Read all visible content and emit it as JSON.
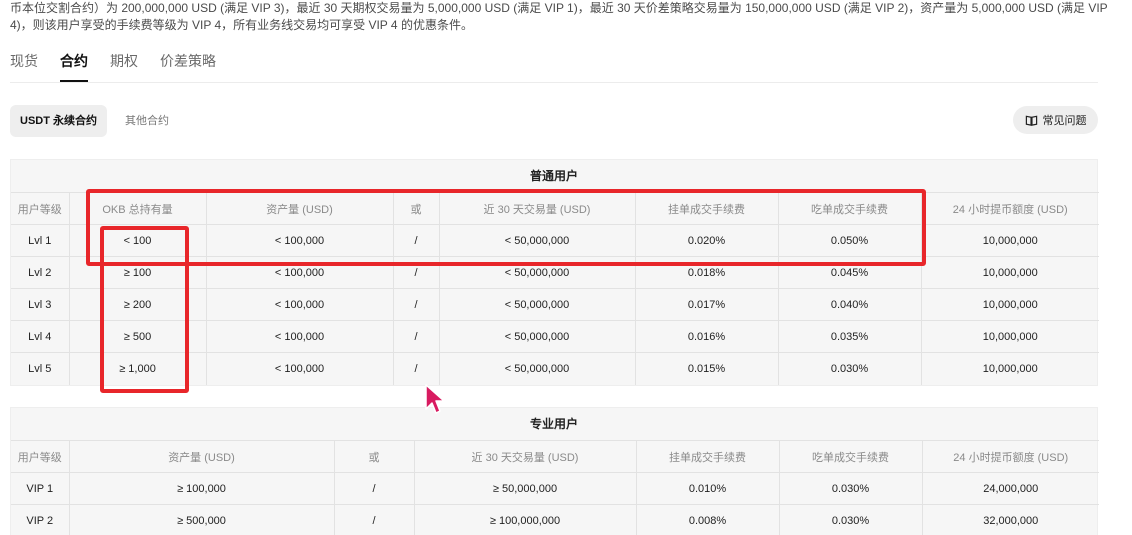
{
  "intro_text": "币本位交割合约）为 200,000,000 USD (满足 VIP 3)，最近 30 天期权交易量为 5,000,000 USD (满足 VIP 1)，最近 30 天价差策略交易量为 150,000,000 USD (满足 VIP 2)，资产量为 5,000,000 USD (满足 VIP 4)，则该用户享受的手续费等级为 VIP 4，所有业务线交易均可享受 VIP 4 的优惠条件。",
  "tabs": [
    "现货",
    "合约",
    "期权",
    "价差策略"
  ],
  "active_tab": "合约",
  "subtabs": [
    "USDT 永续合约",
    "其他合约"
  ],
  "faq_label": "常见问题",
  "regular": {
    "title": "普通用户",
    "columns": [
      "用户等级",
      "OKB 总持有量",
      "资产量 (USD)",
      "或",
      "近 30 天交易量 (USD)",
      "挂单成交手续费",
      "吃单成交手续费",
      "24 小时提币额度 (USD)"
    ],
    "rows": [
      [
        "Lvl 1",
        "< 100",
        "< 100,000",
        "/",
        "< 50,000,000",
        "0.020%",
        "0.050%",
        "10,000,000"
      ],
      [
        "Lvl 2",
        "≥ 100",
        "< 100,000",
        "/",
        "< 50,000,000",
        "0.018%",
        "0.045%",
        "10,000,000"
      ],
      [
        "Lvl 3",
        "≥ 200",
        "< 100,000",
        "/",
        "< 50,000,000",
        "0.017%",
        "0.040%",
        "10,000,000"
      ],
      [
        "Lvl 4",
        "≥ 500",
        "< 100,000",
        "/",
        "< 50,000,000",
        "0.016%",
        "0.035%",
        "10,000,000"
      ],
      [
        "Lvl 5",
        "≥ 1,000",
        "< 100,000",
        "/",
        "< 50,000,000",
        "0.015%",
        "0.030%",
        "10,000,000"
      ]
    ]
  },
  "pro": {
    "title": "专业用户",
    "columns": [
      "用户等级",
      "资产量 (USD)",
      "或",
      "近 30 天交易量 (USD)",
      "挂单成交手续费",
      "吃单成交手续费",
      "24 小时提币额度 (USD)"
    ],
    "rows": [
      [
        "VIP 1",
        "≥ 100,000",
        "/",
        "≥ 50,000,000",
        "0.010%",
        "0.030%",
        "24,000,000"
      ],
      [
        "VIP 2",
        "≥ 500,000",
        "/",
        "≥ 100,000,000",
        "0.008%",
        "0.030%",
        "32,000,000"
      ]
    ]
  },
  "colors": {
    "highlight": "#e8262a",
    "cursor": "#d81b60",
    "panel": "#f6f6f6"
  }
}
